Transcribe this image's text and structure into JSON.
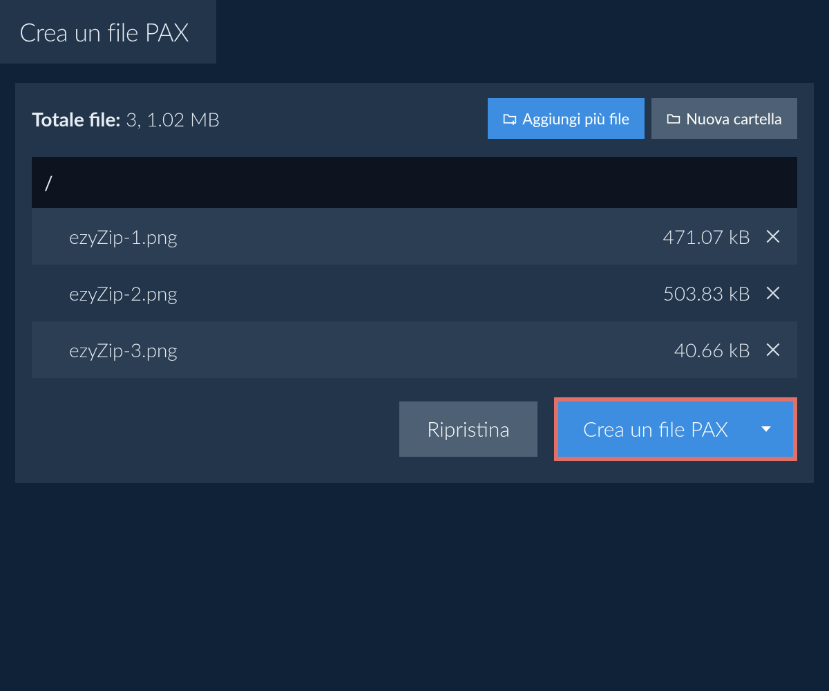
{
  "tab": {
    "title": "Crea un file PAX"
  },
  "summary": {
    "label": "Totale file:",
    "value": "3, 1.02 MB"
  },
  "topActions": {
    "addFiles": "Aggiungi più file",
    "newFolder": "Nuova cartella"
  },
  "path": "/",
  "files": [
    {
      "name": "ezyZip-1.png",
      "size": "471.07 kB"
    },
    {
      "name": "ezyZip-2.png",
      "size": "503.83 kB"
    },
    {
      "name": "ezyZip-3.png",
      "size": "40.66 kB"
    }
  ],
  "footer": {
    "reset": "Ripristina",
    "create": "Crea un file PAX"
  }
}
